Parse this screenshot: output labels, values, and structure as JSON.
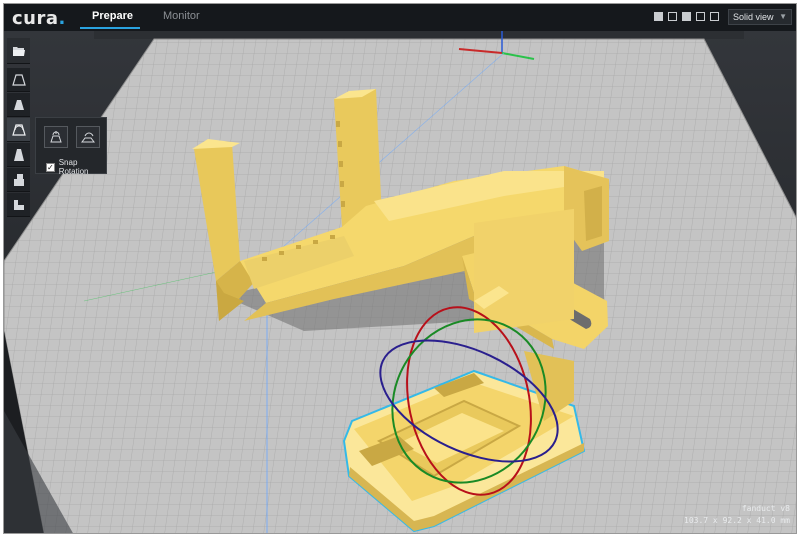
{
  "app": {
    "logo": "cura",
    "logo_dot": "."
  },
  "tabs": [
    {
      "label": "Prepare",
      "active": true
    },
    {
      "label": "Monitor",
      "active": false
    }
  ],
  "view": {
    "selected": "Solid view",
    "icons": [
      "3d-view-icon",
      "front-view-icon",
      "top-view-icon",
      "left-view-icon",
      "right-view-icon"
    ]
  },
  "toolbar": {
    "tools": [
      {
        "icon": "open-file-icon"
      },
      {
        "icon": "translate-icon"
      },
      {
        "icon": "scale-icon"
      },
      {
        "icon": "rotate-icon",
        "active": true
      },
      {
        "icon": "mirror-icon"
      },
      {
        "icon": "per-model-settings-icon"
      },
      {
        "icon": "support-blocker-icon"
      }
    ]
  },
  "rotate_panel": {
    "reset_icon": "reset-rotation-icon",
    "lay_flat_icon": "lay-flat-icon",
    "snap_label": "Snap Rotation",
    "snap_checked": "✓"
  },
  "machine": {
    "name": "fanduct v8",
    "dimensions": "103.7 x 92.2 x 41.0 mm"
  },
  "colors": {
    "accent": "#2aa3e0",
    "model": "#f7dd72",
    "selection_outline": "#35b9e8"
  }
}
